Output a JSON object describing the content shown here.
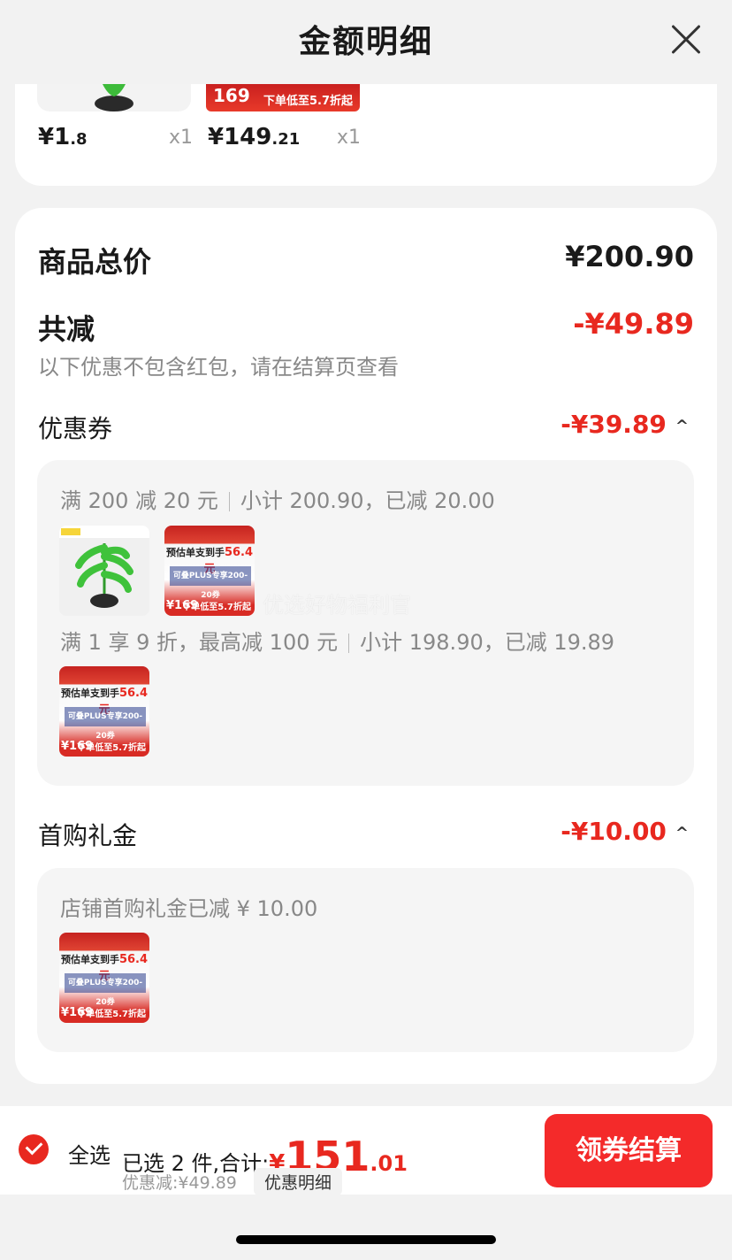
{
  "header": {
    "title": "金额明细"
  },
  "top_products": [
    {
      "price_main": "¥1",
      "price_dec": ".8",
      "qty": "x1"
    },
    {
      "price_main": "¥149",
      "price_dec": ".21",
      "qty": "x1",
      "badge": "169",
      "banner": "下单低至5.7折起"
    }
  ],
  "summary": {
    "total_label": "商品总价",
    "total_value": "¥200.90",
    "reduce_label": "共减",
    "reduce_value": "-¥49.89",
    "note": "以下优惠不包含红包，请在结算页查看"
  },
  "coupons": {
    "label": "优惠券",
    "value": "-¥39.89",
    "rules": [
      {
        "rule": "满 200 减 20 元",
        "sub": "小计 200.90，已减 20.00"
      },
      {
        "rule": "满 1 享 9 折，最高减 100 元",
        "sub": "小计 198.90，已减 19.89"
      }
    ]
  },
  "gift": {
    "label": "首购礼金",
    "value": "-¥10.00",
    "desc": "店铺首购礼金已减 ¥ 10.00"
  },
  "ad": {
    "top_text": "预估单支到手",
    "top_price": "56.4元",
    "plus": "可叠PLUS专享200-20券",
    "badge": "¥169",
    "foot": "下单低至5.7折起"
  },
  "watermark": "优选好物福利官",
  "bottom": {
    "select_all": "全选",
    "selected": "已选 2 件,合计:",
    "total_cur": "¥",
    "total_int": "151",
    "total_dec": ".01",
    "discount": "优惠减:¥49.89",
    "detail": "优惠明细",
    "checkout": "领券结算"
  },
  "colors": {
    "accent": "#e8281f",
    "checkout": "#f42a2a"
  }
}
